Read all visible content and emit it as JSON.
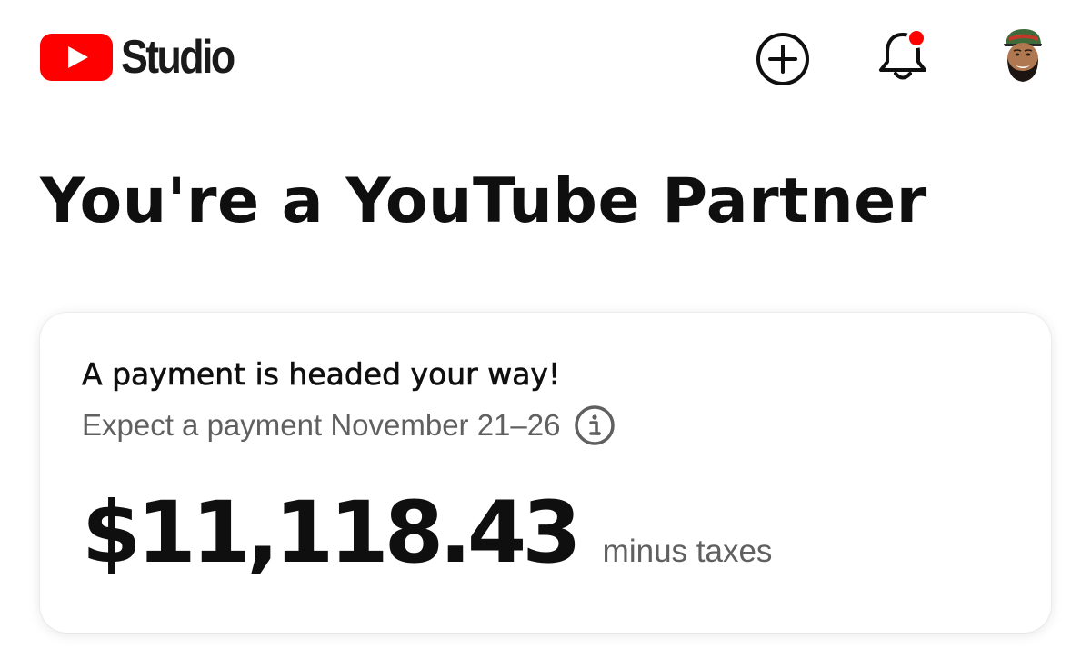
{
  "header": {
    "brand_name": "Studio",
    "brand_color": "#ff0000",
    "notification_dot_color": "#ff0000",
    "create_icon": "plus-circle-icon",
    "notification_icon": "bell-icon",
    "account_icon": "avatar"
  },
  "main": {
    "title": "You're a YouTube Partner"
  },
  "payment_card": {
    "heading": "A payment is headed your way!",
    "expected_text": "Expect a payment November 21–26",
    "info_icon": "info-icon",
    "amount": "$11,118.43",
    "amount_suffix": "minus taxes"
  }
}
